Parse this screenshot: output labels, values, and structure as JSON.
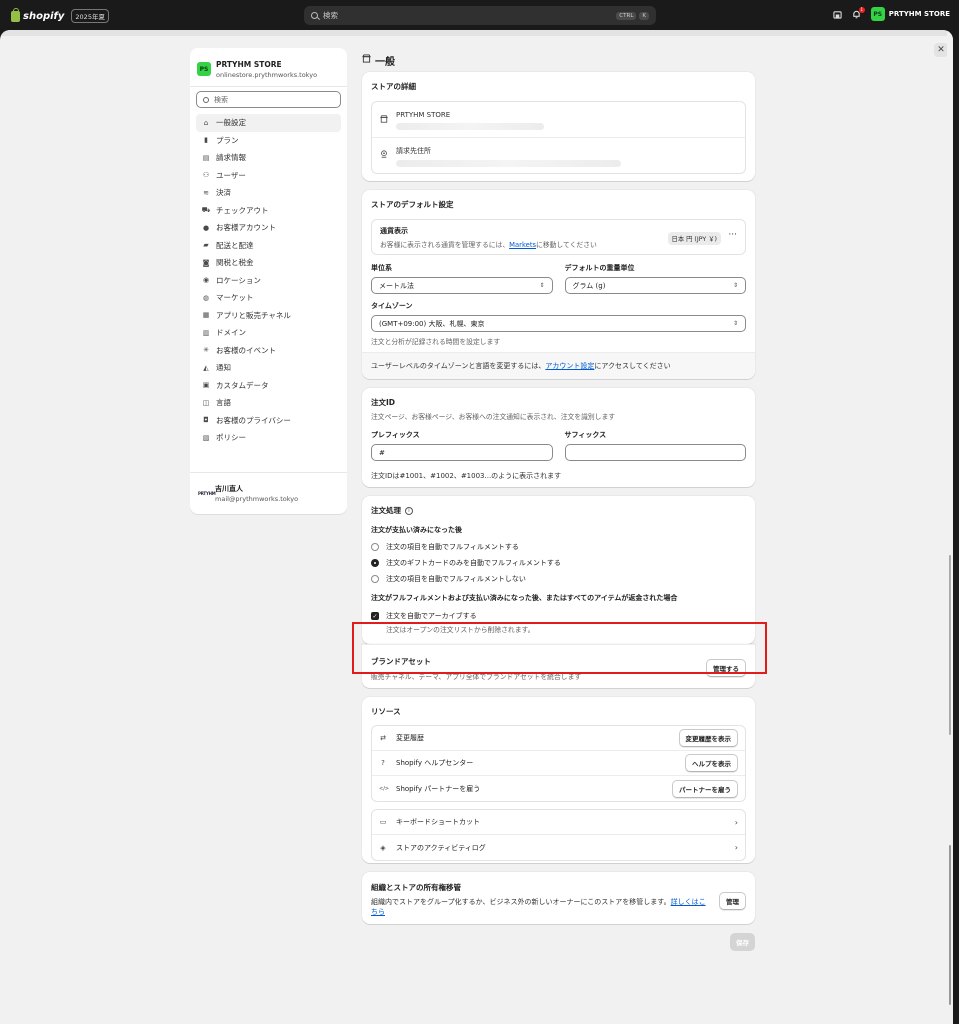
{
  "topbar": {
    "brand": "shopify",
    "year_badge": "2025年夏",
    "search_placeholder": "検索",
    "kbd_ctrl": "CTRL",
    "kbd_k": "K",
    "notification_count": "1",
    "store_initials": "PS",
    "store_name": "PRTYHM STORE"
  },
  "sidebar": {
    "store_initials": "PS",
    "store_name": "PRTYHM STORE",
    "store_domain": "onlinestore.prythmworks.tokyo",
    "search_placeholder": "検索",
    "items": [
      {
        "label": "一般設定",
        "icon": "store-icon"
      },
      {
        "label": "プラン",
        "icon": "plan-icon"
      },
      {
        "label": "請求情報",
        "icon": "billing-icon"
      },
      {
        "label": "ユーザー",
        "icon": "users-icon"
      },
      {
        "label": "決済",
        "icon": "payments-icon"
      },
      {
        "label": "チェックアウト",
        "icon": "cart-icon"
      },
      {
        "label": "お客様アカウント",
        "icon": "person-icon"
      },
      {
        "label": "配送と配達",
        "icon": "truck-icon"
      },
      {
        "label": "関税と税金",
        "icon": "tax-icon"
      },
      {
        "label": "ロケーション",
        "icon": "location-icon"
      },
      {
        "label": "マーケット",
        "icon": "globe-icon"
      },
      {
        "label": "アプリと販売チャネル",
        "icon": "apps-icon"
      },
      {
        "label": "ドメイン",
        "icon": "domain-icon"
      },
      {
        "label": "お客様のイベント",
        "icon": "sparkle-icon"
      },
      {
        "label": "通知",
        "icon": "bell-icon"
      },
      {
        "label": "カスタムデータ",
        "icon": "database-icon"
      },
      {
        "label": "言語",
        "icon": "language-icon"
      },
      {
        "label": "お客様のプライバシー",
        "icon": "lock-icon"
      },
      {
        "label": "ポリシー",
        "icon": "policy-icon"
      }
    ],
    "user_logo": "PRTYHM",
    "user_name": "吉川直人",
    "user_email": "mail@prythmworks.tokyo"
  },
  "page": {
    "title": "一般",
    "store_details": {
      "heading": "ストアの詳細",
      "store_name": "PRTYHM STORE",
      "billing_address_label": "請求先住所"
    },
    "defaults": {
      "heading": "ストアのデフォルト設定",
      "currency_label": "通貨表示",
      "currency_desc_pre": "お客様に表示される通貨を管理するには、",
      "currency_desc_link": "Markets",
      "currency_desc_post": "に移動してください",
      "currency_badge": "日本 円 (JPY ￥)",
      "unit_label": "単位系",
      "unit_value": "メートル法",
      "weight_label": "デフォルトの重量単位",
      "weight_value": "グラム (g)",
      "tz_label": "タイムゾーン",
      "tz_value": "(GMT+09:00) 大阪、札幌、東京",
      "tz_help": "注文と分析が記録される時間を設定します",
      "footer_pre": "ユーザーレベルのタイムゾーンと言語を変更するには、",
      "footer_link": "アカウント設定",
      "footer_post": "にアクセスしてください"
    },
    "order_id": {
      "heading": "注文ID",
      "desc": "注文ページ、お客様ページ、お客様への注文通知に表示され、注文を識別します",
      "prefix_label": "プレフィックス",
      "prefix_value": "#",
      "suffix_label": "サフィックス",
      "suffix_value": "",
      "example": "注文IDは#1001、#1002、#1003...のように表示されます"
    },
    "order_processing": {
      "heading": "注文処理",
      "after_paid_label": "注文が支払い済みになった後",
      "options": [
        {
          "label": "注文の項目を自動でフルフィルメントする",
          "selected": false
        },
        {
          "label": "注文のギフトカードのみを自動でフルフィルメントする",
          "selected": true
        },
        {
          "label": "注文の項目を自動でフルフィルメントしない",
          "selected": false
        }
      ],
      "after_fulfilled_label": "注文がフルフィルメントおよび支払い済みになった後、またはすべてのアイテムが返金された場合",
      "archive_label": "注文を自動でアーカイブする",
      "archive_help": "注文はオープンの注文リストから削除されます。"
    },
    "brand_assets": {
      "heading": "ブランドアセット",
      "desc": "販売チャネル、テーマ、アプリ全体でブランドアセットを統合します",
      "button": "管理する"
    },
    "resources": {
      "heading": "リソース",
      "group1": [
        {
          "label": "変更履歴",
          "button": "変更履歴を表示",
          "icon": "history-icon"
        },
        {
          "label": "Shopify ヘルプセンター",
          "button": "ヘルプを表示",
          "icon": "help-icon"
        },
        {
          "label": "Shopify パートナーを雇う",
          "button": "パートナーを雇う",
          "icon": "code-icon"
        }
      ],
      "group2": [
        {
          "label": "キーボードショートカット",
          "icon": "keyboard-icon"
        },
        {
          "label": "ストアのアクティビティログ",
          "icon": "activity-icon"
        }
      ]
    },
    "ownership": {
      "heading": "組織とストアの所有権移管",
      "desc_pre": "組織内でストアをグループ化するか、ビジネス外の新しいオーナーにこのストアを移管します。",
      "desc_link": "詳しくはこちら",
      "button": "管理"
    },
    "save_button": "保存"
  },
  "colors": {
    "accent_green": "#36d246",
    "link_blue": "#005bd3",
    "highlight_red": "#e21b1b"
  }
}
